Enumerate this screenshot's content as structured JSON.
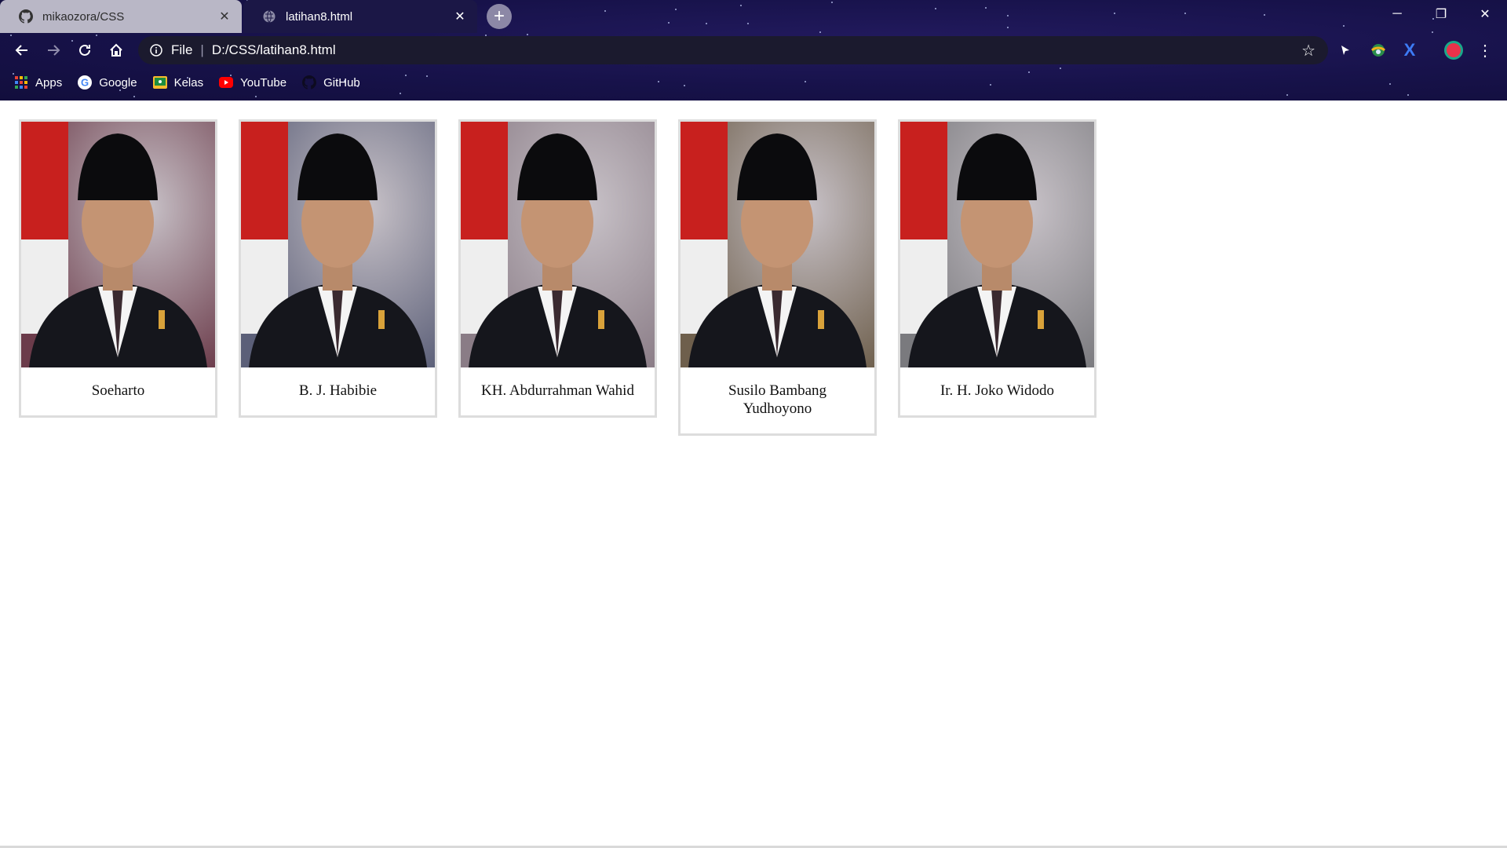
{
  "browser": {
    "tabs": [
      {
        "title": "mikaozora/CSS",
        "icon": "github-icon",
        "active": false
      },
      {
        "title": "latihan8.html",
        "icon": "globe-icon",
        "active": true
      }
    ],
    "new_tab_label": "+",
    "window_controls": {
      "minimize": "─",
      "restore": "❐",
      "close": "✕"
    },
    "address_bar": {
      "scheme": "File",
      "url": "D:/CSS/latihan8.html"
    },
    "bookmarks": [
      {
        "label": "Apps",
        "icon": "apps-grid-icon"
      },
      {
        "label": "Google",
        "icon": "google-icon"
      },
      {
        "label": "Kelas",
        "icon": "classroom-icon"
      },
      {
        "label": "YouTube",
        "icon": "youtube-icon"
      },
      {
        "label": "GitHub",
        "icon": "github-icon"
      }
    ],
    "colors": {
      "chrome_bg": "#17124a",
      "omnibox_bg": "#1b1a2e",
      "inactive_tab": "#b9b7c6"
    }
  },
  "gallery": {
    "cards": [
      {
        "name": "Soeharto",
        "portrait_bg": "#6b3b4a",
        "flag": true
      },
      {
        "name": "B. J. Habibie",
        "portrait_bg": "#5b5f78",
        "flag": true
      },
      {
        "name": "KH. Abdurrahman Wahid",
        "portrait_bg": "#8a7c86",
        "flag": true
      },
      {
        "name": "Susilo Bambang Yudhoyono",
        "portrait_bg": "#6e5f4c",
        "flag": true
      },
      {
        "name": "Ir. H. Joko Widodo",
        "portrait_bg": "#7a7a7e",
        "flag": true
      }
    ],
    "border_color": "#dddddd"
  }
}
